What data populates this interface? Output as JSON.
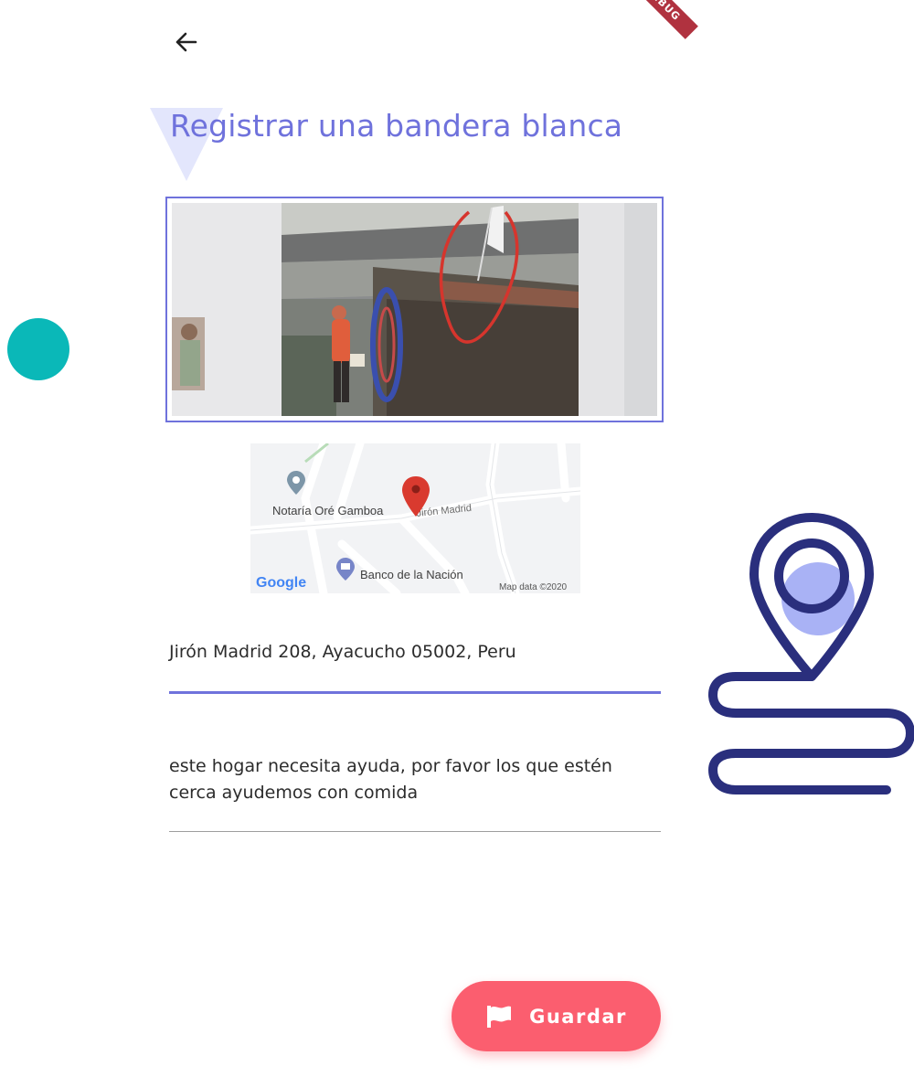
{
  "app": {
    "debug_badge": "DEBUG",
    "back_icon": "arrow-left-icon"
  },
  "header": {
    "title": "Registrar una bandera blanca"
  },
  "map": {
    "place_1": "Notaría Oré Gamboa",
    "street": "Jirón Madrid",
    "place_2": "Banco de la Nación",
    "provider": "Google",
    "attribution": "Map data ©2020"
  },
  "form": {
    "address_value": "Jirón Madrid 208, Ayacucho 05002, Peru",
    "description_value": "este hogar necesita ayuda, por favor los que estén cerca ayudemos con comida"
  },
  "actions": {
    "save_label": "Guardar",
    "save_icon": "flag-icon"
  },
  "colors": {
    "accent": "#6f72dc",
    "save_button": "#fb5e6f",
    "teal_decor": "#0ab8b8",
    "illustration": "#2a2f7d"
  }
}
